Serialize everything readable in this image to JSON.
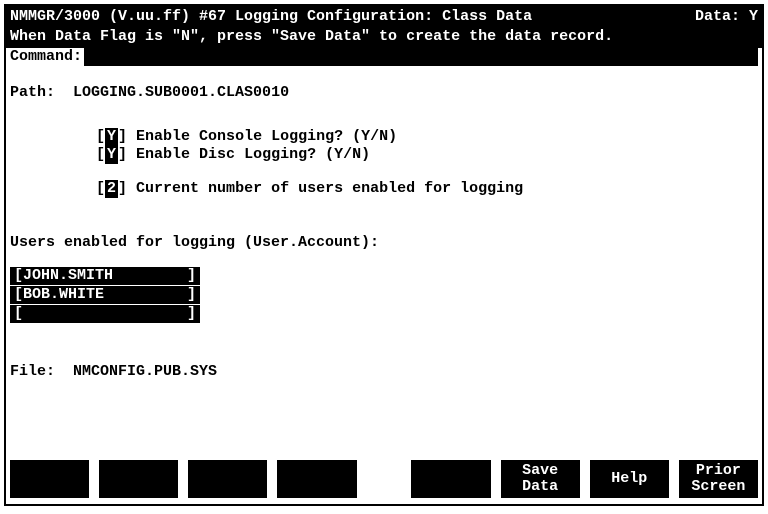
{
  "header": {
    "title": "NMMGR/3000 (V.uu.ff) #67 Logging Configuration: Class Data",
    "data_flag_label": "Data:",
    "data_flag_value": "Y",
    "hint": "When Data Flag is \"N\", press \"Save Data\" to create the data record.",
    "command_label": "Command:"
  },
  "path": {
    "label": "Path:",
    "value": "LOGGING.SUB0001.CLAS0010"
  },
  "options": {
    "console": {
      "value": "Y",
      "label": "Enable Console Logging? (Y/N)"
    },
    "disc": {
      "value": "Y",
      "label": "Enable Disc Logging? (Y/N)"
    },
    "count": {
      "value": "2",
      "label": "Current number of users enabled for logging"
    }
  },
  "users": {
    "heading": "Users enabled for logging (User.Account):",
    "rows": [
      {
        "value": "JOHN.SMITH"
      },
      {
        "value": "BOB.WHITE"
      },
      {
        "value": ""
      }
    ]
  },
  "file": {
    "label": "File:",
    "value": "NMCONFIG.PUB.SYS"
  },
  "fkeys": {
    "f1": "",
    "f2": "",
    "f3": "",
    "f4": "",
    "f5": "",
    "f6_l1": "Save",
    "f6_l2": "Data",
    "f7": "Help",
    "f8_l1": "Prior",
    "f8_l2": "Screen"
  }
}
